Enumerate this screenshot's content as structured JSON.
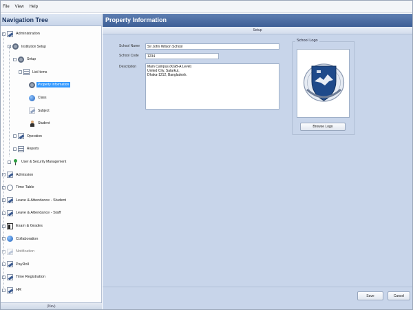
{
  "menu": [
    "File",
    "View",
    "Help"
  ],
  "nav": {
    "title": "Navigation Tree",
    "footer": "(Nav)",
    "items": [
      {
        "label": "Administration",
        "level": 0,
        "icon": "admin-icon",
        "expander": "-"
      },
      {
        "label": "Institution Setup",
        "level": 1,
        "icon": "institution-icon",
        "expander": "-"
      },
      {
        "label": "Setup",
        "level": 2,
        "icon": "setup-icon",
        "expander": "-"
      },
      {
        "label": "List Items",
        "level": 3,
        "icon": "list-items-icon",
        "expander": "-"
      },
      {
        "label": "Property Information",
        "level": 4,
        "icon": "property-info-icon",
        "expander": "",
        "selected": true
      },
      {
        "label": "Class",
        "level": 4,
        "icon": "class-icon",
        "expander": ""
      },
      {
        "label": "Subject",
        "level": 4,
        "icon": "subject-icon",
        "expander": ""
      },
      {
        "label": "Student",
        "level": 4,
        "icon": "student-icon",
        "expander": ""
      },
      {
        "label": "Operation",
        "level": 2,
        "icon": "operation-icon",
        "expander": "+"
      },
      {
        "label": "Reports",
        "level": 2,
        "icon": "reports-icon",
        "expander": "+"
      },
      {
        "label": "User & Security Management",
        "level": 1,
        "icon": "security-icon",
        "expander": "+"
      },
      {
        "label": "Admission",
        "level": 0,
        "icon": "admission-icon",
        "expander": "+"
      },
      {
        "label": "Time Table",
        "level": 0,
        "icon": "timetable-icon",
        "expander": "+"
      },
      {
        "label": "Leave & Attendance - Student",
        "level": 0,
        "icon": "leave-student-icon",
        "expander": "+"
      },
      {
        "label": "Leave & Attendance - Staff",
        "level": 0,
        "icon": "leave-staff-icon",
        "expander": "+"
      },
      {
        "label": "Exam & Grades",
        "level": 0,
        "icon": "exam-icon",
        "expander": "+"
      },
      {
        "label": "Collaboration",
        "level": 0,
        "icon": "collaboration-icon",
        "expander": "+"
      },
      {
        "label": "Notification",
        "level": 0,
        "icon": "notification-icon",
        "expander": "+",
        "faded": true
      },
      {
        "label": "PayRoll",
        "level": 0,
        "icon": "payroll-icon",
        "expander": "+"
      },
      {
        "label": "Time Registration",
        "level": 0,
        "icon": "time-registration-icon",
        "expander": "+"
      },
      {
        "label": "HR",
        "level": 0,
        "icon": "hr-icon",
        "expander": "+"
      }
    ]
  },
  "main": {
    "title": "Property Information",
    "section": "Setup",
    "form": {
      "school_name_label": "School Name",
      "school_name_value": "Sir John Wilson School",
      "school_code_label": "School Code",
      "school_code_value": "1234",
      "description_label": "Description",
      "description_lines": [
        "Main Campus (KGB-A Level)",
        "United City, Satarkul,",
        "Dhaka-1212, Bangladesh."
      ]
    },
    "logo": {
      "caption": "School Logo",
      "browse_label": "Browse Logo",
      "colors": {
        "shield": "#1f4a8a",
        "ring": "#c9d3e2"
      }
    },
    "buttons": {
      "save": "Save",
      "cancel": "Cancel"
    }
  },
  "colors": {
    "accent": "#3399ff",
    "header": "#4a6ba2",
    "panel": "#c8d5ea"
  }
}
